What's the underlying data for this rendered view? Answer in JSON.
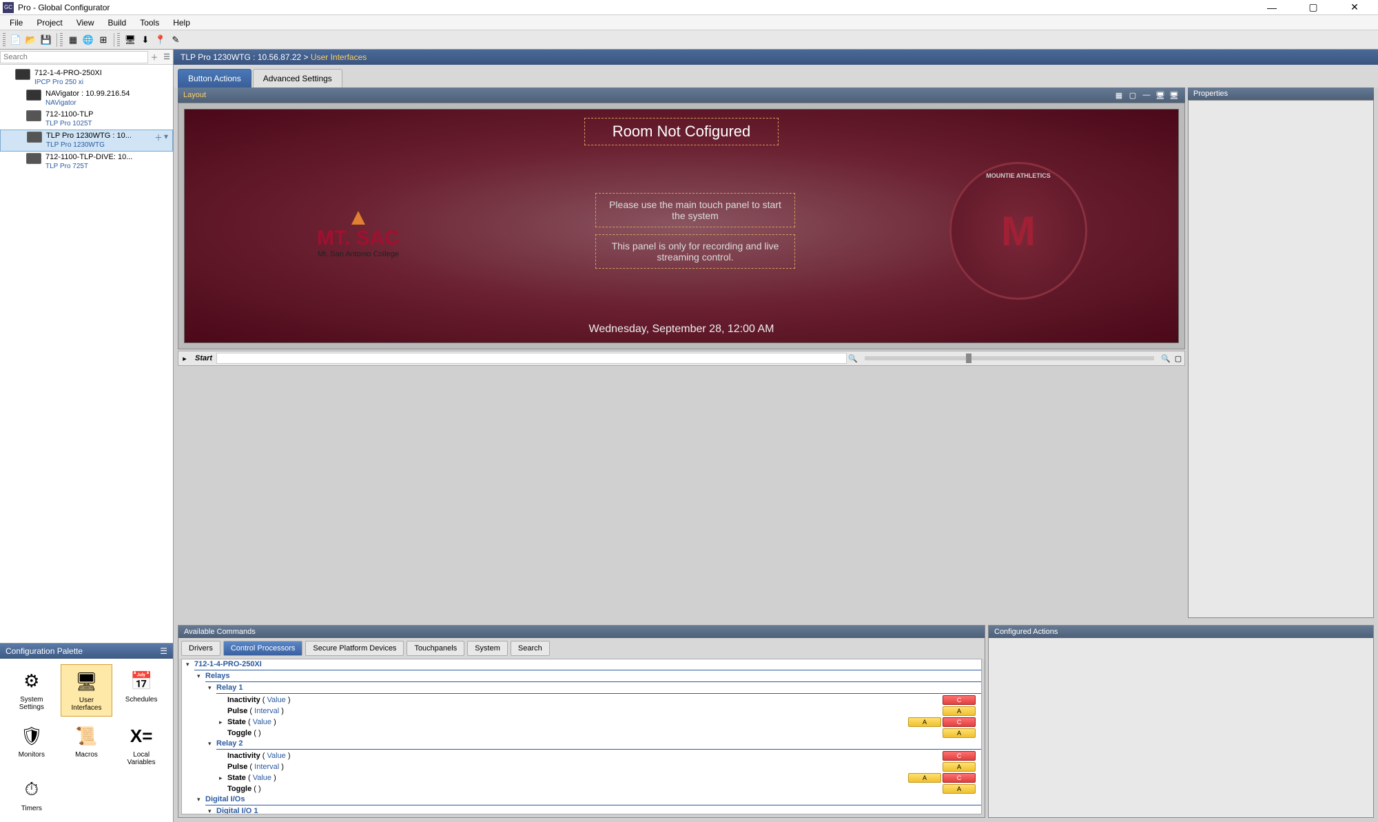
{
  "window": {
    "app_icon_text": "GC",
    "title": "Pro - Global Configurator",
    "minimize": "—",
    "maximize": "▢",
    "close": "✕"
  },
  "menu": [
    "File",
    "Project",
    "View",
    "Build",
    "Tools",
    "Help"
  ],
  "search": {
    "placeholder": "Search"
  },
  "devices": [
    {
      "l1": "712-1-4-PRO-250XI",
      "l2": "IPCP Pro 250 xi",
      "icon": "box"
    },
    {
      "l1": "NAVigator : 10.99.216.54",
      "l2": "NAVigator",
      "icon": "box"
    },
    {
      "l1": "712-1100-TLP",
      "l2": "TLP Pro 1025T",
      "icon": "screen"
    },
    {
      "l1": "TLP Pro 1230WTG : 10...",
      "l2": "TLP Pro 1230WTG",
      "icon": "screen",
      "selected": true
    },
    {
      "l1": "712-1100-TLP-DIVE: 10...",
      "l2": "TLP Pro 725T",
      "icon": "screen"
    }
  ],
  "palette": {
    "title": "Configuration Palette",
    "items": [
      {
        "label": "System\nSettings",
        "icon": "⚙"
      },
      {
        "label": "User\nInterfaces",
        "icon": "🖥",
        "selected": true
      },
      {
        "label": "Schedules",
        "icon": "📅"
      },
      {
        "label": "Monitors",
        "icon": "🛡"
      },
      {
        "label": "Macros",
        "icon": "📜"
      },
      {
        "label": "Local\nVariables",
        "icon": "X="
      },
      {
        "label": "Timers",
        "icon": "⏱"
      }
    ]
  },
  "breadcrumb": {
    "device": "TLP Pro 1230WTG : 10.56.87.22",
    "sep": " > ",
    "page": "User Interfaces"
  },
  "subtabs": [
    {
      "label": "Button Actions",
      "active": true
    },
    {
      "label": "Advanced Settings"
    }
  ],
  "layout_panel": {
    "title": "Layout"
  },
  "props_panel": {
    "title": "Properties"
  },
  "preview": {
    "title": "Room Not Cofigured",
    "logo_main": "MT. SAC",
    "logo_sub": "Mt. San Antonio College",
    "msg1": "Please use the main touch panel to start the system",
    "msg2": "This panel is only for recording and live streaming control.",
    "badge_ring": "MOUNTIE ATHLETICS",
    "badge_letter": "M",
    "datetime": "Wednesday, September 28, 12:00 AM"
  },
  "page_nav": {
    "label": "Start"
  },
  "avail_panel": {
    "title": "Available Commands"
  },
  "actions_panel": {
    "title": "Configured Actions"
  },
  "cmd_tabs": [
    {
      "label": "Drivers"
    },
    {
      "label": "Control Processors",
      "active": true
    },
    {
      "label": "Secure Platform Devices"
    },
    {
      "label": "Touchpanels"
    },
    {
      "label": "System"
    },
    {
      "label": "Search"
    }
  ],
  "cmd_tree": {
    "root": "712-1-4-PRO-250XI",
    "groups": [
      {
        "name": "Relays",
        "children": [
          {
            "name": "Relay 1",
            "items": [
              {
                "cmd": "Inactivity",
                "param": "Value",
                "badges": [
                  "C"
                ]
              },
              {
                "cmd": "Pulse",
                "param": "Interval",
                "badges": [
                  "A"
                ]
              },
              {
                "cmd": "State",
                "param": "Value",
                "badges": [
                  "A",
                  "C"
                ]
              },
              {
                "cmd": "Toggle",
                "param": "",
                "badges": [
                  "A"
                ]
              }
            ]
          },
          {
            "name": "Relay 2",
            "items": [
              {
                "cmd": "Inactivity",
                "param": "Value",
                "badges": [
                  "C"
                ]
              },
              {
                "cmd": "Pulse",
                "param": "Interval",
                "badges": [
                  "A"
                ]
              },
              {
                "cmd": "State",
                "param": "Value",
                "badges": [
                  "A",
                  "C"
                ]
              },
              {
                "cmd": "Toggle",
                "param": "",
                "badges": [
                  "A"
                ]
              }
            ]
          }
        ]
      },
      {
        "name": "Digital I/Os",
        "children": [
          {
            "name": "Digital I/O 1",
            "items": []
          }
        ]
      }
    ]
  }
}
